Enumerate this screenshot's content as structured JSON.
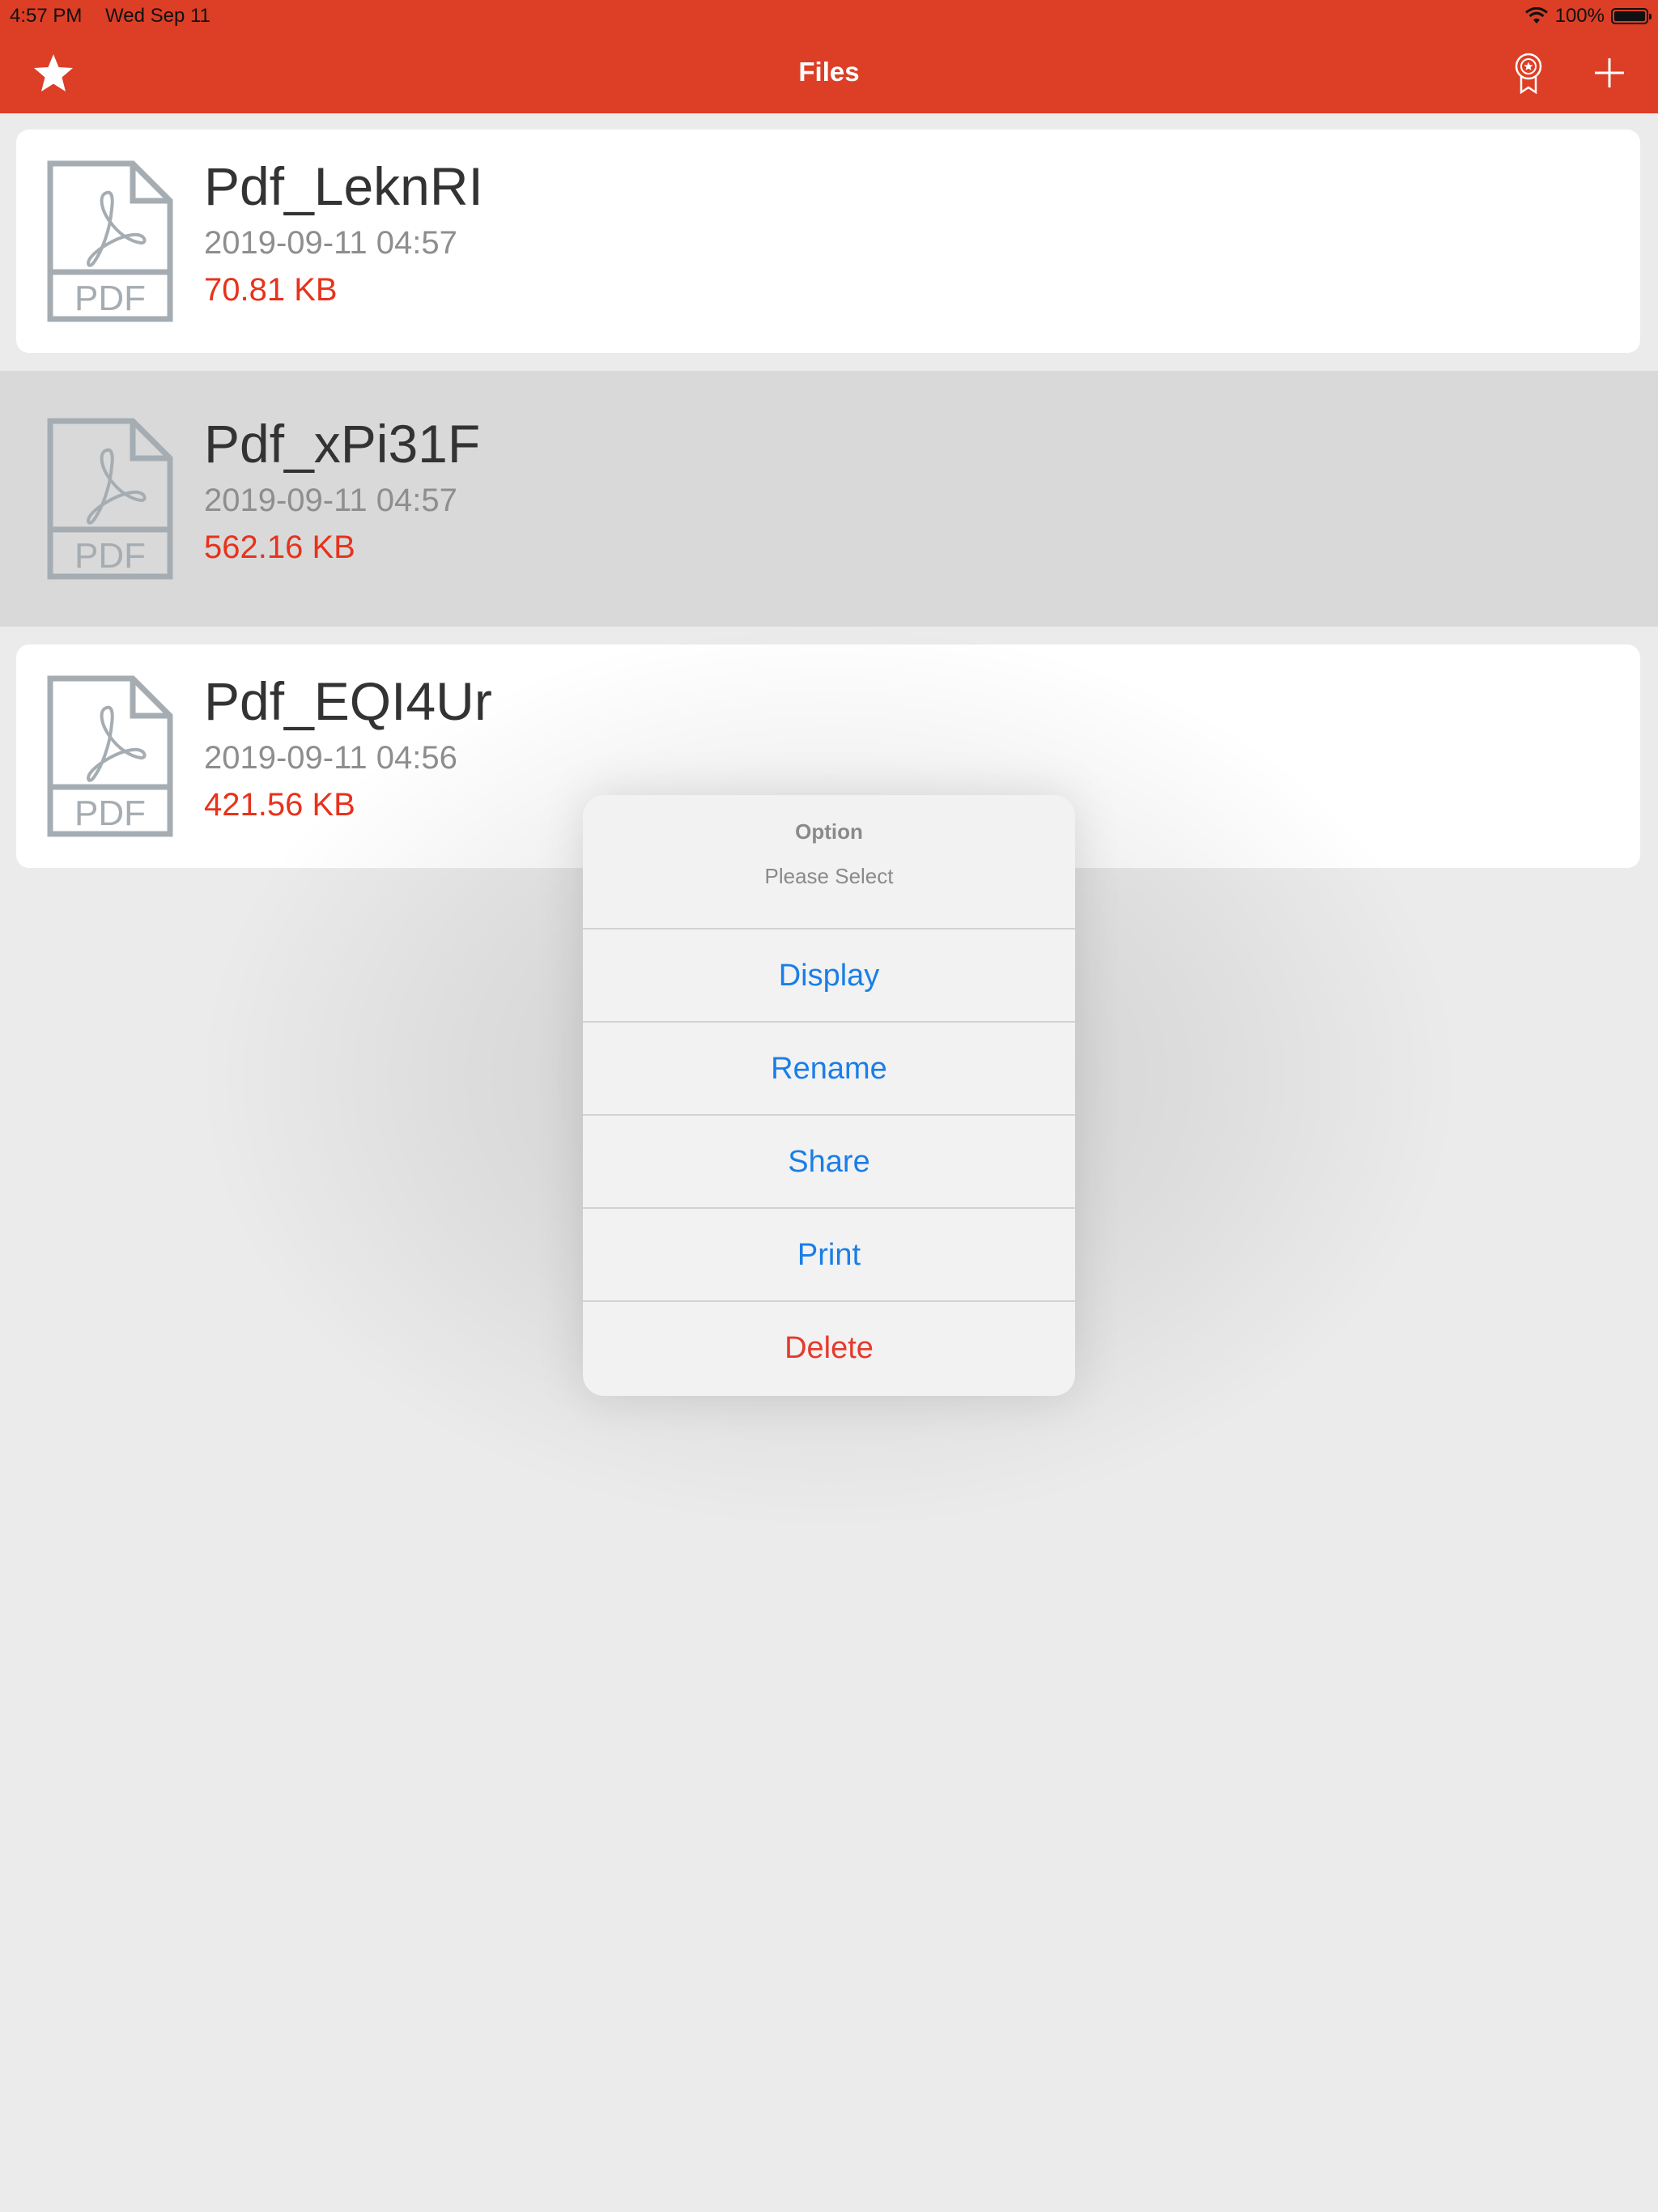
{
  "status_bar": {
    "time": "4:57 PM",
    "date": "Wed Sep 11",
    "battery": "100%",
    "icons": [
      "wifi-icon",
      "battery-icon"
    ]
  },
  "nav_bar": {
    "title": "Files",
    "left_icon": "star-icon",
    "right_icons": [
      "award-icon",
      "plus-icon"
    ],
    "accent_color": "#dd3e26"
  },
  "files": [
    {
      "name": "Pdf_LeknRI",
      "date": "2019-09-11 04:57",
      "size": "70.81 KB",
      "icon": "pdf-file-icon",
      "icon_label": "PDF"
    },
    {
      "name": "Pdf_xPi31F",
      "date": "2019-09-11 04:57",
      "size": "562.16 KB",
      "icon": "pdf-file-icon",
      "icon_label": "PDF",
      "selected": true
    },
    {
      "name": "Pdf_EQI4Ur",
      "date": "2019-09-11 04:56",
      "size": "421.56 KB",
      "icon": "pdf-file-icon",
      "icon_label": "PDF"
    }
  ],
  "action_sheet": {
    "title": "Option",
    "message": "Please Select",
    "options": [
      "Display",
      "Rename",
      "Share",
      "Print",
      "Delete"
    ],
    "option_color": "#1a7ee8",
    "destructive_color": "#e53a2e"
  }
}
